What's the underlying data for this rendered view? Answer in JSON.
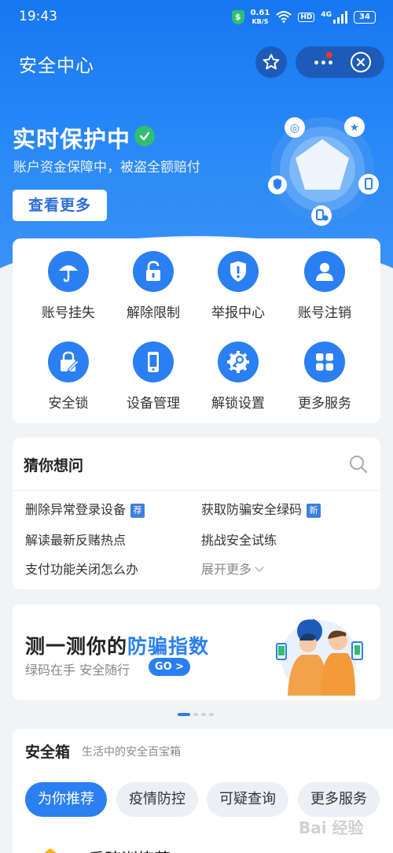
{
  "status_bar": {
    "time": "19:43",
    "speed_value": "0.61",
    "speed_unit": "KB/S",
    "hd": "HD",
    "network": "4G",
    "battery": "34"
  },
  "header": {
    "title": "安全中心"
  },
  "protection": {
    "status": "实时保护中",
    "subtitle": "账户资金保障中，被盗全额赔付",
    "view_more": "查看更多"
  },
  "services": [
    {
      "label": "账号挂失",
      "icon": "umbrella-icon"
    },
    {
      "label": "解除限制",
      "icon": "unlock-icon"
    },
    {
      "label": "举报中心",
      "icon": "report-shield-icon"
    },
    {
      "label": "账号注销",
      "icon": "user-icon"
    },
    {
      "label": "安全锁",
      "icon": "lock-pen-icon"
    },
    {
      "label": "设备管理",
      "icon": "phone-icon"
    },
    {
      "label": "解锁设置",
      "icon": "gear-key-icon"
    },
    {
      "label": "更多服务",
      "icon": "grid-icon"
    }
  ],
  "guess": {
    "title": "猜你想问",
    "questions": [
      {
        "text": "删除异常登录设备",
        "tag": "荐"
      },
      {
        "text": "获取防骗安全绿码",
        "tag": "新"
      },
      {
        "text": "解读最新反赌热点",
        "tag": ""
      },
      {
        "text": "挑战安全试练",
        "tag": ""
      },
      {
        "text": "支付功能关闭怎么办",
        "tag": ""
      }
    ],
    "expand": "展开更多"
  },
  "banner": {
    "title_prefix": "测一测你的",
    "title_highlight": "防骗指数",
    "subtitle": "绿码在手 安全随行",
    "go": "GO >"
  },
  "safe_box": {
    "title": "安全箱",
    "subtitle": "生活中的安全百宝箱",
    "chips": [
      "为你推荐",
      "疫情防控",
      "可疑查询",
      "更多服务"
    ],
    "first_item": "反赌训练营"
  },
  "watermark": "Bai 经验",
  "colors": {
    "primary": "#2a7ff2",
    "hero": "#1677f2",
    "check": "#2fbf71",
    "badge_red": "#f5342e"
  }
}
